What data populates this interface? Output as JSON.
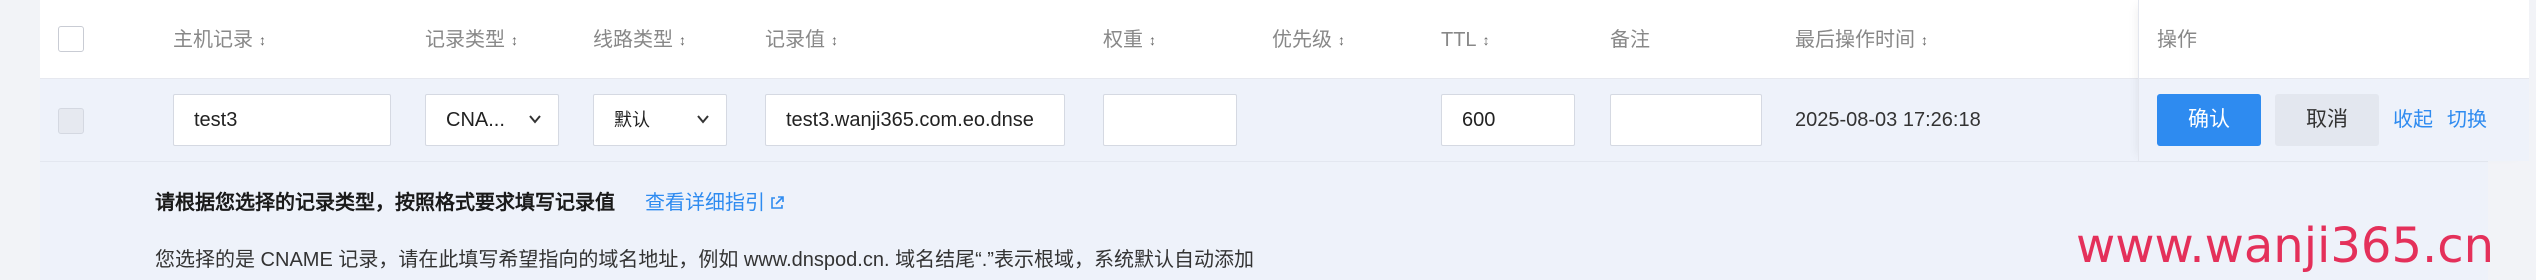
{
  "header": {
    "host": "主机记录",
    "type": "记录类型",
    "line": "线路类型",
    "value": "记录值",
    "weight": "权重",
    "priority": "优先级",
    "ttl": "TTL",
    "remark": "备注",
    "last_op_time": "最后操作时间",
    "ops": "操作",
    "sort_icon": "↕"
  },
  "row": {
    "host": "test3",
    "type": "CNA...",
    "line": "默认",
    "value": "test3.wanji365.com.eo.dnse",
    "weight": "",
    "ttl": "600",
    "remark": "",
    "last_op_time": "2025-08-03 17:26:18"
  },
  "actions": {
    "confirm": "确认",
    "cancel": "取消",
    "collapse": "收起",
    "switch": "切换"
  },
  "hint": {
    "title": "请根据您选择的记录类型，按照格式要求填写记录值",
    "link": "查看详细指引",
    "description": "您选择的是 CNAME 记录，请在此填写希望指向的域名地址，例如 www.dnspod.cn. 域名结尾“.”表示根域，系统默认自动添加"
  },
  "watermark": "www.wanji365.cn",
  "colors": {
    "accent": "#2e8bf0",
    "watermark": "#e4305a"
  }
}
